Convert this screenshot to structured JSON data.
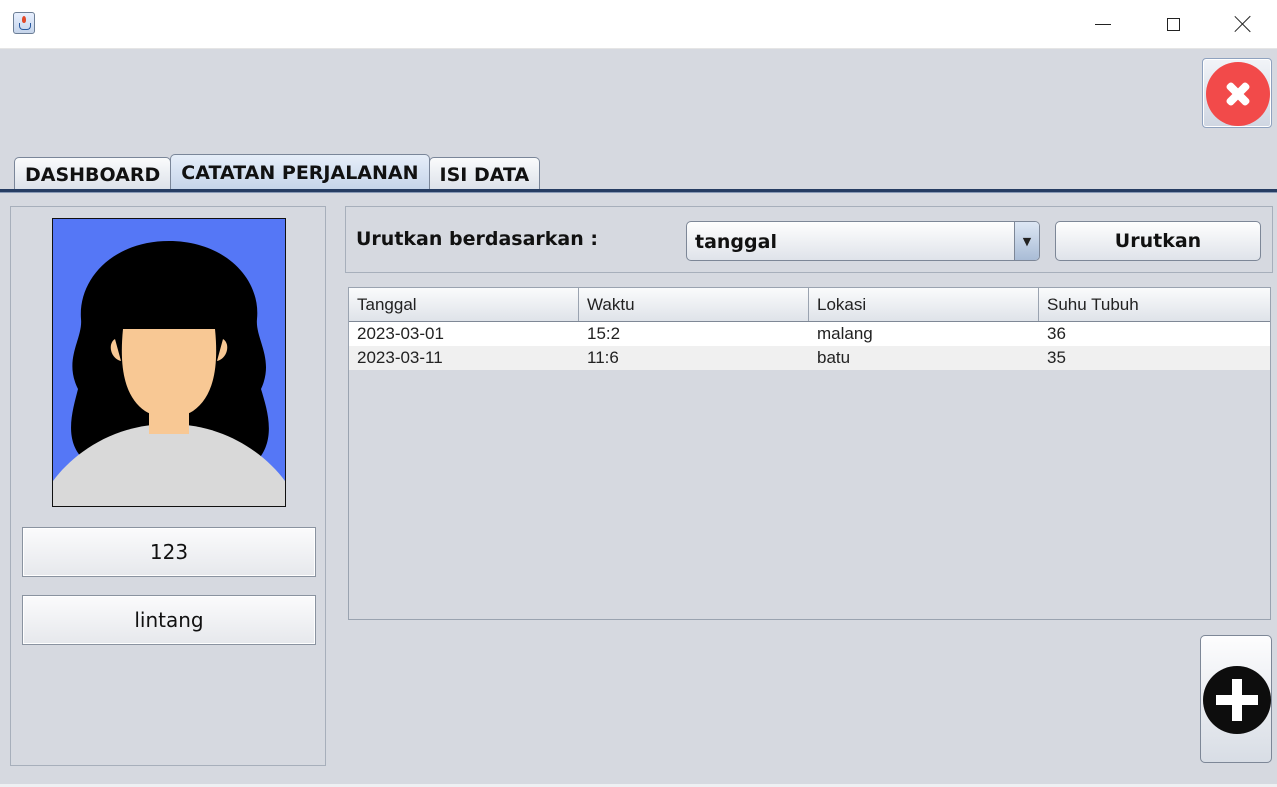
{
  "window": {
    "title": "",
    "minimize_icon": "minimize-icon",
    "maximize_icon": "maximize-icon",
    "close_icon": "close-icon"
  },
  "header": {
    "exit_button_icon": "red-circle-x-icon"
  },
  "tabs": [
    {
      "label": "DASHBOARD",
      "active": false
    },
    {
      "label": "CATATAN PERJALANAN",
      "active": true
    },
    {
      "label": "ISI DATA",
      "active": false
    }
  ],
  "profile": {
    "avatar_icon": "woman-avatar",
    "id": "123",
    "name": "lintang"
  },
  "sort": {
    "label": "Urutkan berdasarkan :",
    "selected": "tanggal",
    "button_label": "Urutkan"
  },
  "table": {
    "columns": [
      "Tanggal",
      "Waktu",
      "Lokasi",
      "Suhu Tubuh"
    ],
    "rows": [
      [
        "2023-03-01",
        "15:2",
        "malang",
        "36"
      ],
      [
        "2023-03-11",
        "11:6",
        "batu",
        "35"
      ]
    ]
  },
  "actions": {
    "add_icon": "plus-circle-icon"
  },
  "colors": {
    "avatar_bg": "#5577f6",
    "exit_red": "#f24a4a",
    "tab_rule": "#263d63"
  }
}
